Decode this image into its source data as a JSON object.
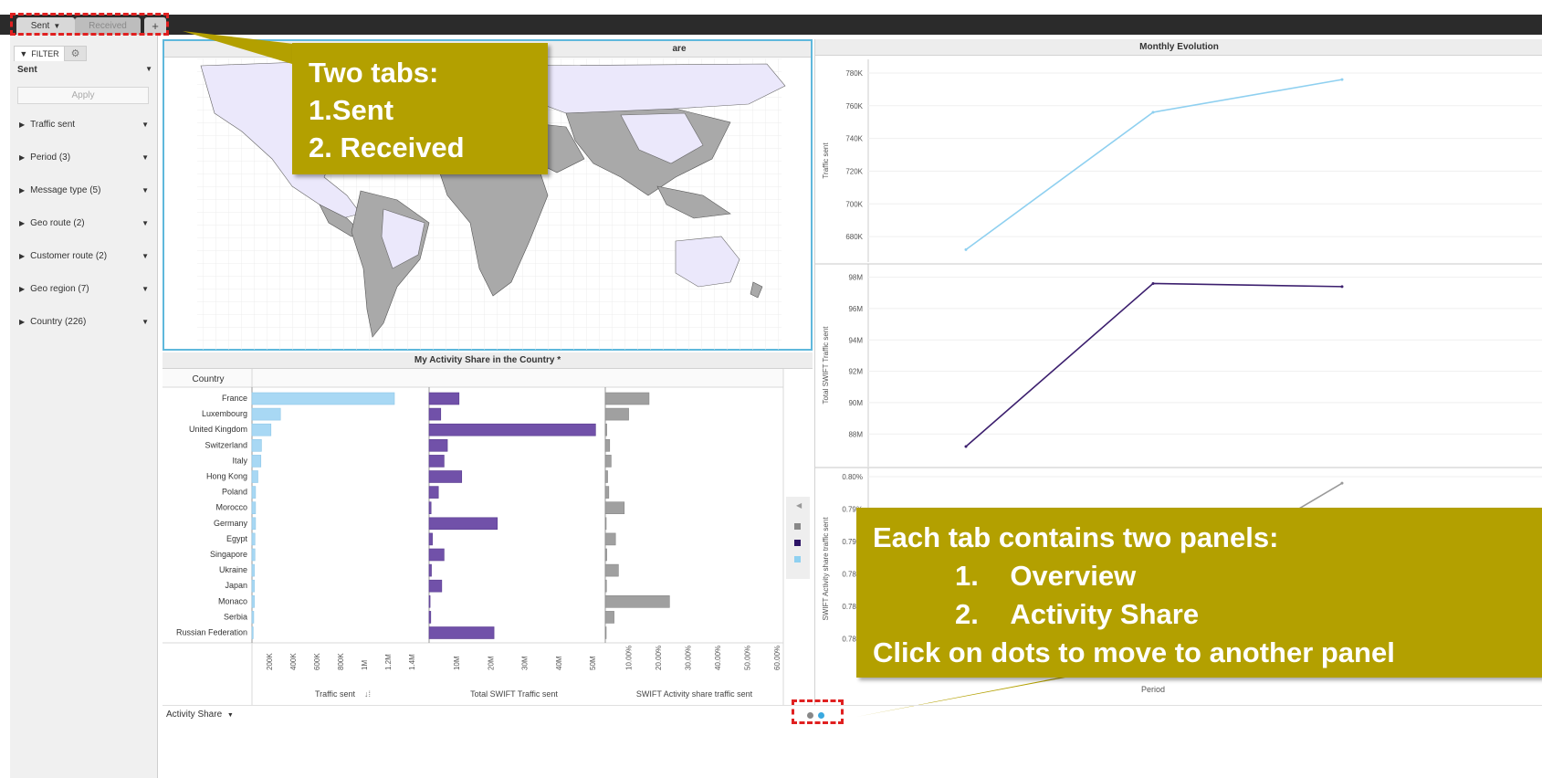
{
  "tabs": {
    "sent": "Sent",
    "received": "Received",
    "add": "+"
  },
  "sidebar": {
    "filter_label": "FILTER",
    "scope_value": "Sent",
    "apply_label": "Apply",
    "items": [
      {
        "label": "Traffic sent"
      },
      {
        "label": "Period (3)"
      },
      {
        "label": "Message type (5)"
      },
      {
        "label": "Geo route (2)"
      },
      {
        "label": "Customer route (2)"
      },
      {
        "label": "Geo region (7)"
      },
      {
        "label": "Country (226)"
      }
    ]
  },
  "map_panel": {
    "title_visible": "are"
  },
  "activity_panel": {
    "title": "My Activity Share in the Country *",
    "country_header": "Country",
    "sort_icon": "sort-icon"
  },
  "monthly_panel": {
    "title": "Monthly Evolution",
    "x_label": "Period"
  },
  "callouts": {
    "tabs": {
      "title": "Two tabs:",
      "item1": "1.Sent",
      "item2": "2. Received"
    },
    "panels": {
      "title": "Each tab contains two panels:",
      "item1_num": "1.",
      "item1": "Overview",
      "item2_num": "2.",
      "item2": "Activity Share",
      "footer": "Click on dots to move to another panel"
    }
  },
  "footer": {
    "panel_selector": "Activity Share"
  },
  "colors": {
    "traffic": "#a8d8f4",
    "total": "#6b4fa0",
    "share": "#a0a0a0",
    "accent": "#5fb8dc",
    "callout": "#b3a000",
    "highlight": "#e02020",
    "active_dot": "#3aa9e0"
  },
  "chart_data": [
    {
      "type": "bar",
      "title": "My Activity Share in the Country *",
      "orientation": "horizontal",
      "categories": [
        "France",
        "Luxembourg",
        "United Kingdom",
        "Switzerland",
        "Italy",
        "Hong Kong",
        "Poland",
        "Morocco",
        "Germany",
        "Egypt",
        "Singapore",
        "Ukraine",
        "Japan",
        "Monaco",
        "Serbia",
        "Russian Federation"
      ],
      "series": [
        {
          "name": "Traffic sent",
          "ticks": [
            "200K",
            "400K",
            "600K",
            "800K",
            "1M",
            "1.2M",
            "1.4M"
          ],
          "xlim": [
            0,
            1400000
          ],
          "values": [
            1200000,
            240000,
            160000,
            80000,
            75000,
            50000,
            30000,
            30000,
            30000,
            25000,
            25000,
            20000,
            20000,
            20000,
            15000,
            10000
          ]
        },
        {
          "name": "Total SWIFT Traffic sent",
          "ticks": [
            "10M",
            "20M",
            "30M",
            "40M",
            "50M"
          ],
          "xlim": [
            0,
            51000000
          ],
          "values": [
            9000000,
            3500000,
            50000000,
            5500000,
            4500000,
            9800000,
            2800000,
            600000,
            20500000,
            1000000,
            4500000,
            700000,
            3800000,
            300000,
            500000,
            19500000
          ]
        },
        {
          "name": "SWIFT Activity share traffic sent",
          "ticks": [
            "10.00%",
            "20.00%",
            "30.00%",
            "40.00%",
            "50.00%",
            "60.00%"
          ],
          "xlim": [
            0,
            61
          ],
          "values": [
            15,
            8,
            0.5,
            1.5,
            2,
            0.8,
            1.2,
            6.5,
            0.3,
            3.5,
            0.5,
            4.5,
            0.4,
            22,
            3,
            0.3
          ]
        }
      ]
    },
    {
      "type": "line",
      "title": "Monthly Evolution",
      "xlabel": "Period",
      "panels": [
        {
          "ylabel": "Traffic sent",
          "color": "#8fd0f0",
          "ylim": [
            670,
            785
          ],
          "y_ticks": [
            "780K",
            "760K",
            "740K",
            "720K",
            "700K",
            "680K"
          ],
          "y_tick_values": [
            780,
            760,
            740,
            720,
            700,
            680
          ],
          "values": [
            672,
            756,
            776
          ]
        },
        {
          "ylabel": "Total SWIFT Traffic sent",
          "color": "#3c1f6e",
          "ylim": [
            86.5,
            98.5
          ],
          "y_ticks": [
            "98M",
            "96M",
            "94M",
            "92M",
            "90M",
            "88M"
          ],
          "y_tick_values": [
            98,
            96,
            94,
            92,
            90,
            88
          ],
          "values": [
            87.2,
            97.6,
            97.4
          ]
        },
        {
          "ylabel": "SWIFT Activity share traffic sent",
          "color": "#9a9a9a",
          "ylim": [
            0.7825,
            0.801
          ],
          "y_ticks": [
            "0.80%",
            "0.79%",
            "0.79%",
            "0.78%",
            "0.78%",
            "0.78%"
          ],
          "y_tick_values": [
            0.8,
            0.79,
            0.79,
            0.78,
            0.78,
            0.78
          ],
          "values": [
            0.784,
            0.789,
            0.8
          ]
        }
      ]
    }
  ]
}
